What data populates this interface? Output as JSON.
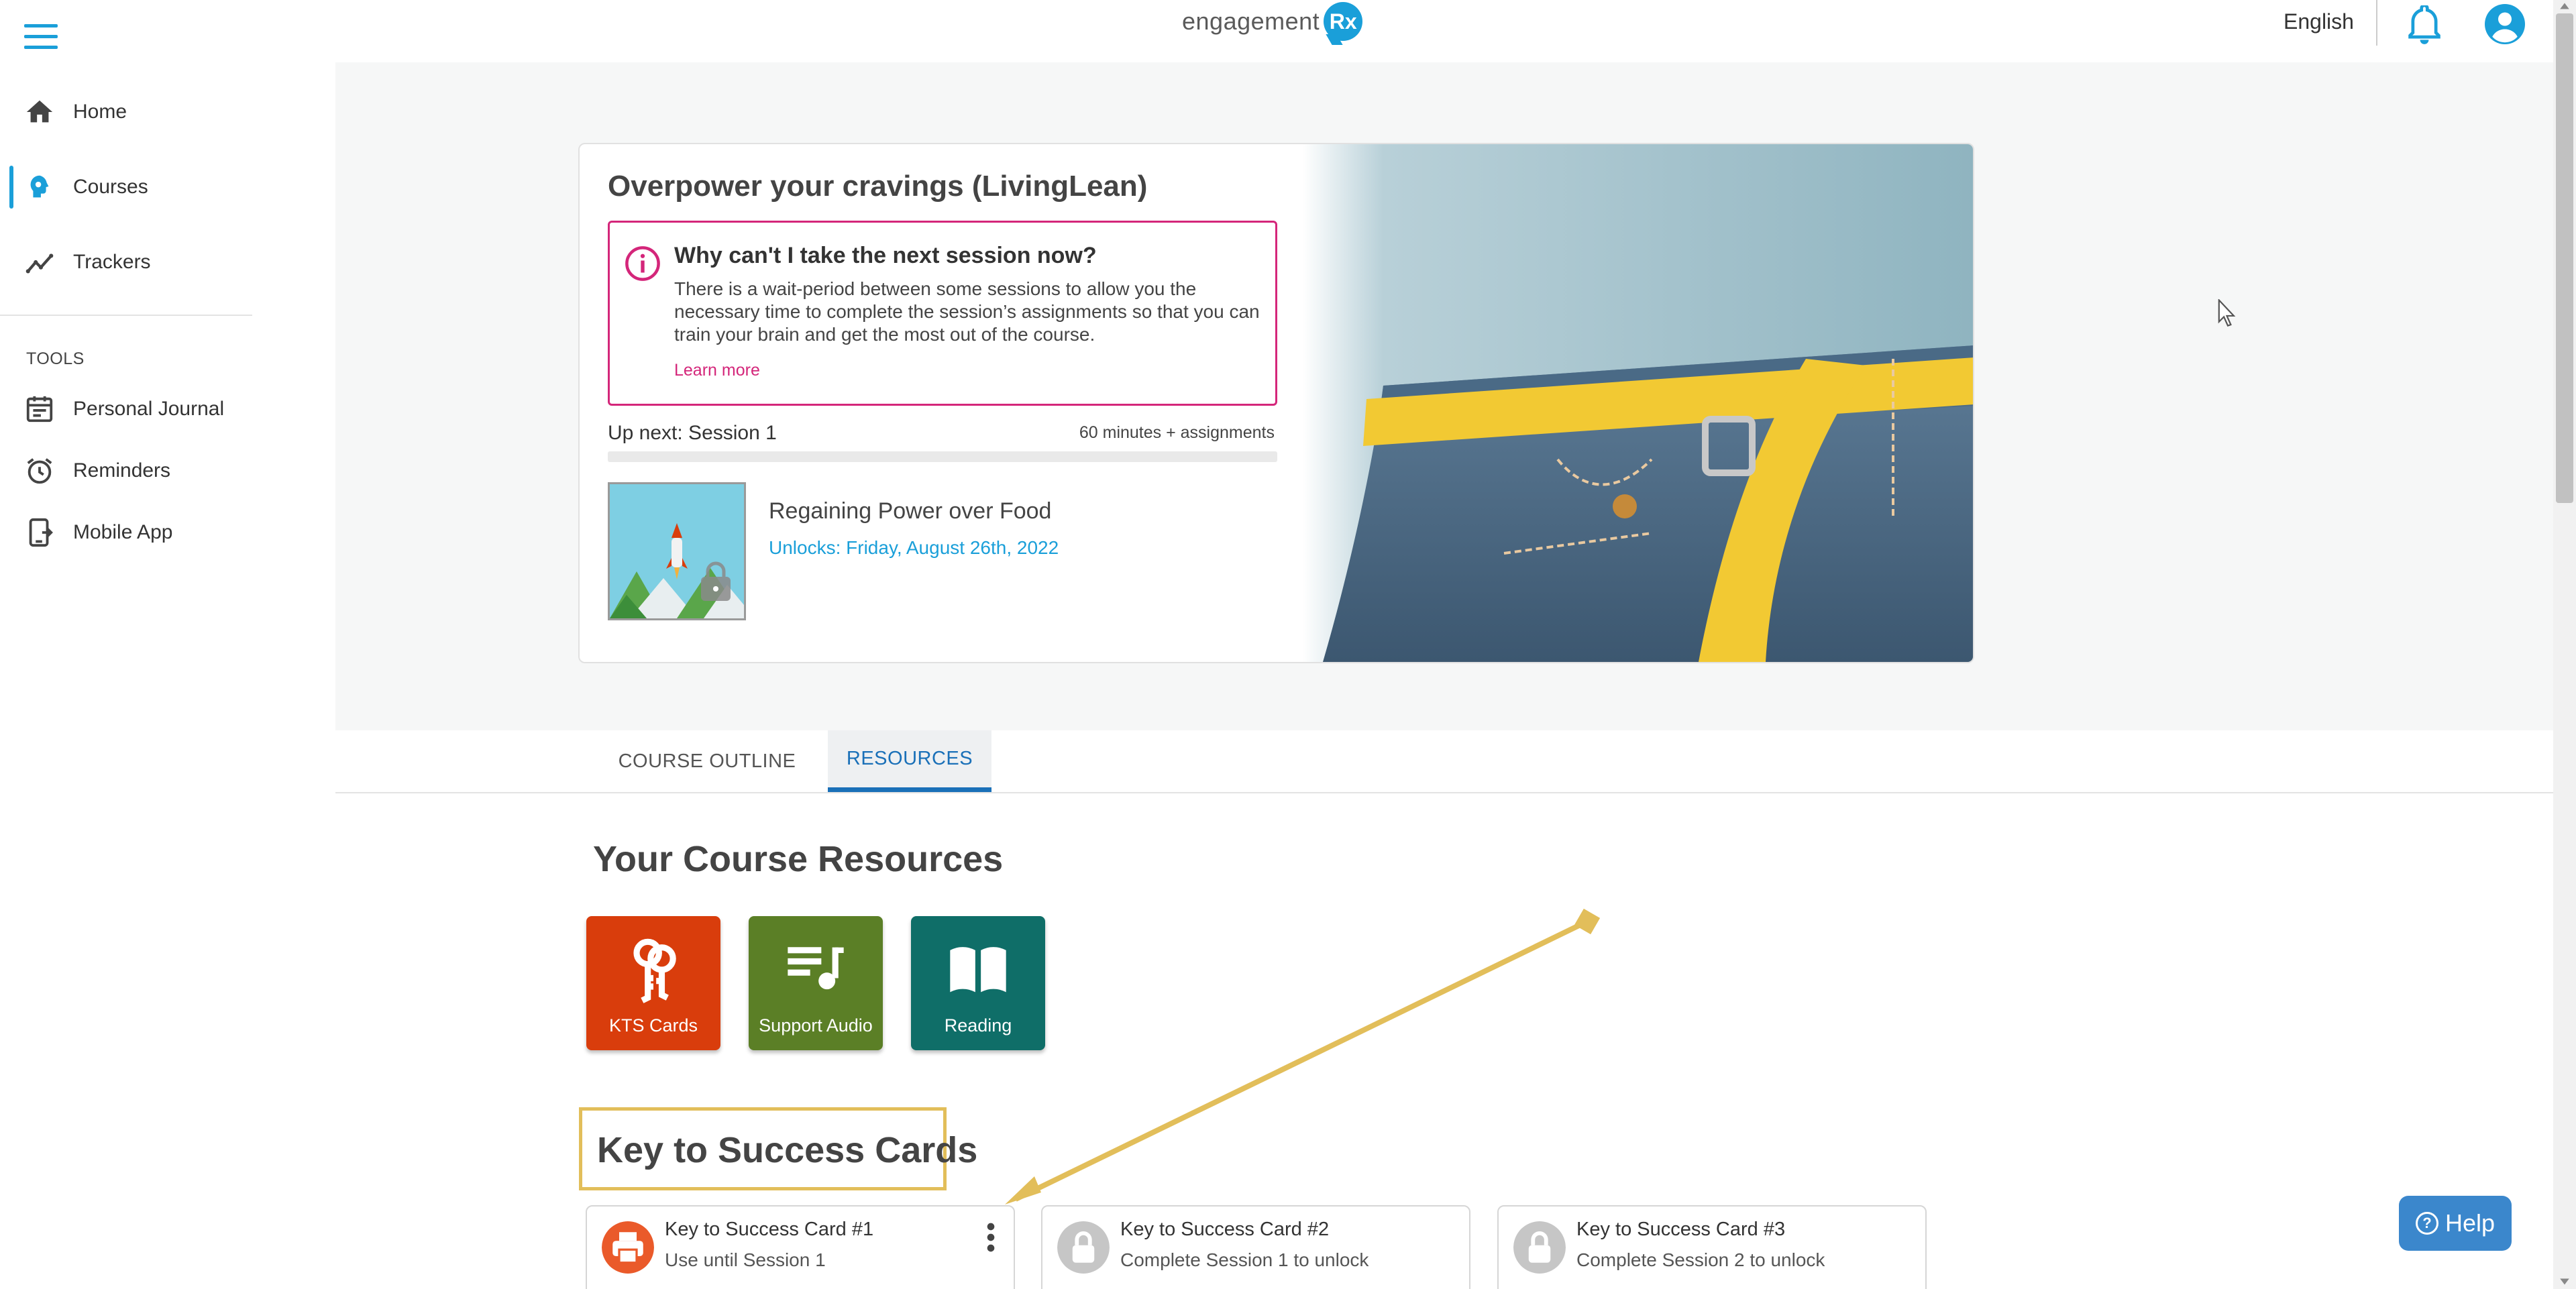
{
  "header": {
    "logo_text": "engagement",
    "logo_badge": "Rx",
    "language": "English"
  },
  "sidebar": {
    "items": [
      {
        "label": "Home",
        "icon": "home-icon"
      },
      {
        "label": "Courses",
        "icon": "courses-icon",
        "active": true
      },
      {
        "label": "Trackers",
        "icon": "trackers-icon"
      }
    ],
    "tools_label": "TOOLS",
    "tools": [
      {
        "label": "Personal Journal",
        "icon": "journal-icon"
      },
      {
        "label": "Reminders",
        "icon": "alarm-icon"
      },
      {
        "label": "Mobile App",
        "icon": "mobile-app-icon"
      }
    ]
  },
  "course": {
    "title": "Overpower your cravings (LivingLean)",
    "notice": {
      "title": "Why can't I take the next session now?",
      "body": "There is a wait-period between some sessions to allow you the necessary time to complete the session’s assignments so that you can train your brain and get the most out of the course.",
      "link": "Learn more"
    },
    "up_next": "Up next: Session 1",
    "duration": "60 minutes + assignments",
    "progress": 0,
    "session": {
      "title": "Regaining Power over Food",
      "unlocks": "Unlocks: Friday, August 26th, 2022"
    }
  },
  "tabs": [
    {
      "label": "COURSE OUTLINE",
      "active": false
    },
    {
      "label": "RESOURCES",
      "active": true
    }
  ],
  "resources": {
    "heading": "Your Course Resources",
    "tiles": [
      {
        "label": "KTS Cards",
        "color": "#d93d0c"
      },
      {
        "label": "Support Audio",
        "color": "#5b7f26"
      },
      {
        "label": "Reading",
        "color": "#0f6e68"
      }
    ]
  },
  "kts": {
    "heading": "Key to Success Cards",
    "cards": [
      {
        "title": "Key to Success Card #1",
        "subtitle": "Use until Session 1",
        "icon": "print-icon",
        "locked": false
      },
      {
        "title": "Key to Success Card #2",
        "subtitle": "Complete Session 1 to unlock",
        "icon": "lock-icon",
        "locked": true
      },
      {
        "title": "Key to Success Card #3",
        "subtitle": "Complete Session 2 to unlock",
        "icon": "lock-icon",
        "locked": true
      }
    ]
  },
  "help": {
    "label": "Help"
  },
  "colors": {
    "accent": "#1a9fd9",
    "notice_border": "#d4267a",
    "annotation": "#e2be5a"
  }
}
